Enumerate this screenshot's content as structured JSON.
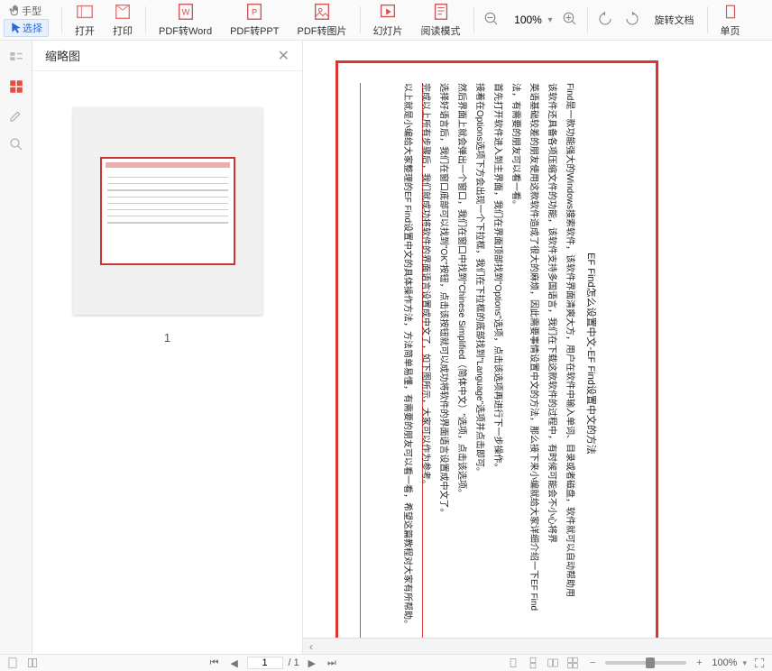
{
  "toolbar": {
    "hand_tool": "手型",
    "select_tool": "选择",
    "open": "打开",
    "print": "打印",
    "pdf_to_word": "PDF转Word",
    "pdf_to_ppt": "PDF转PPT",
    "pdf_to_image": "PDF转图片",
    "slideshow": "幻灯片",
    "reading_mode": "阅读模式",
    "zoom_value": "100%",
    "rotate_doc": "旋转文档",
    "single_page": "单页"
  },
  "thumbnails": {
    "title": "缩略图",
    "page_number": "1"
  },
  "document": {
    "title": "EF Find怎么设置中文-EF Find设置中文的方法",
    "paragraphs": [
      "Find是一款功能强大的Windows搜索软件，该软件界面清爽大方，用户在软件中输入单词、目录或者磁盘，软件就可以自动帮助用",
      "该软件还具备各项压缩文件的功能，该软件支持多国语言，我们在下载这款软件的过程中，有时候可能会不小心将界",
      "英语基础较差的朋友使用这款软件造成了很大的麻烦，因此需要事情设置中文的方法，那么接下来小编就给大家详细介绍一下EF Find",
      "法，有需要的朋友可以看一看。",
      "首先打开软件进入到主界面，我们在界面顶部找到\"Options\"选项，点击该选项再进行下一步操作。",
      "接着在Options选项下方会出现一个下拉框，我们在下拉框的底部找到\"Language\"选项并点击即可。",
      "然后界面上就会弹出一个窗口，我们在窗口中找到\"Chinese Simplified（简体中文）\"选项，点击该选项。",
      "选择好语言后，我们在窗口底部可以找到\"OK\"按钮，点击该按钮就可以成功将软件的界面语言设置成中文了。",
      "完成以上所有步骤后，我们就成功将软件的界面语言设置成中文了，如下图所示，大家可以作为参考。",
      "以上就是小编给大家整理的EF Find设置中文的具体操作方法，方法简单易懂，有需要的朋友可以看一看，希望这篇教程对大家有所帮助。"
    ]
  },
  "statusbar": {
    "page_input": "1",
    "page_total": "/ 1",
    "zoom": "100%"
  }
}
